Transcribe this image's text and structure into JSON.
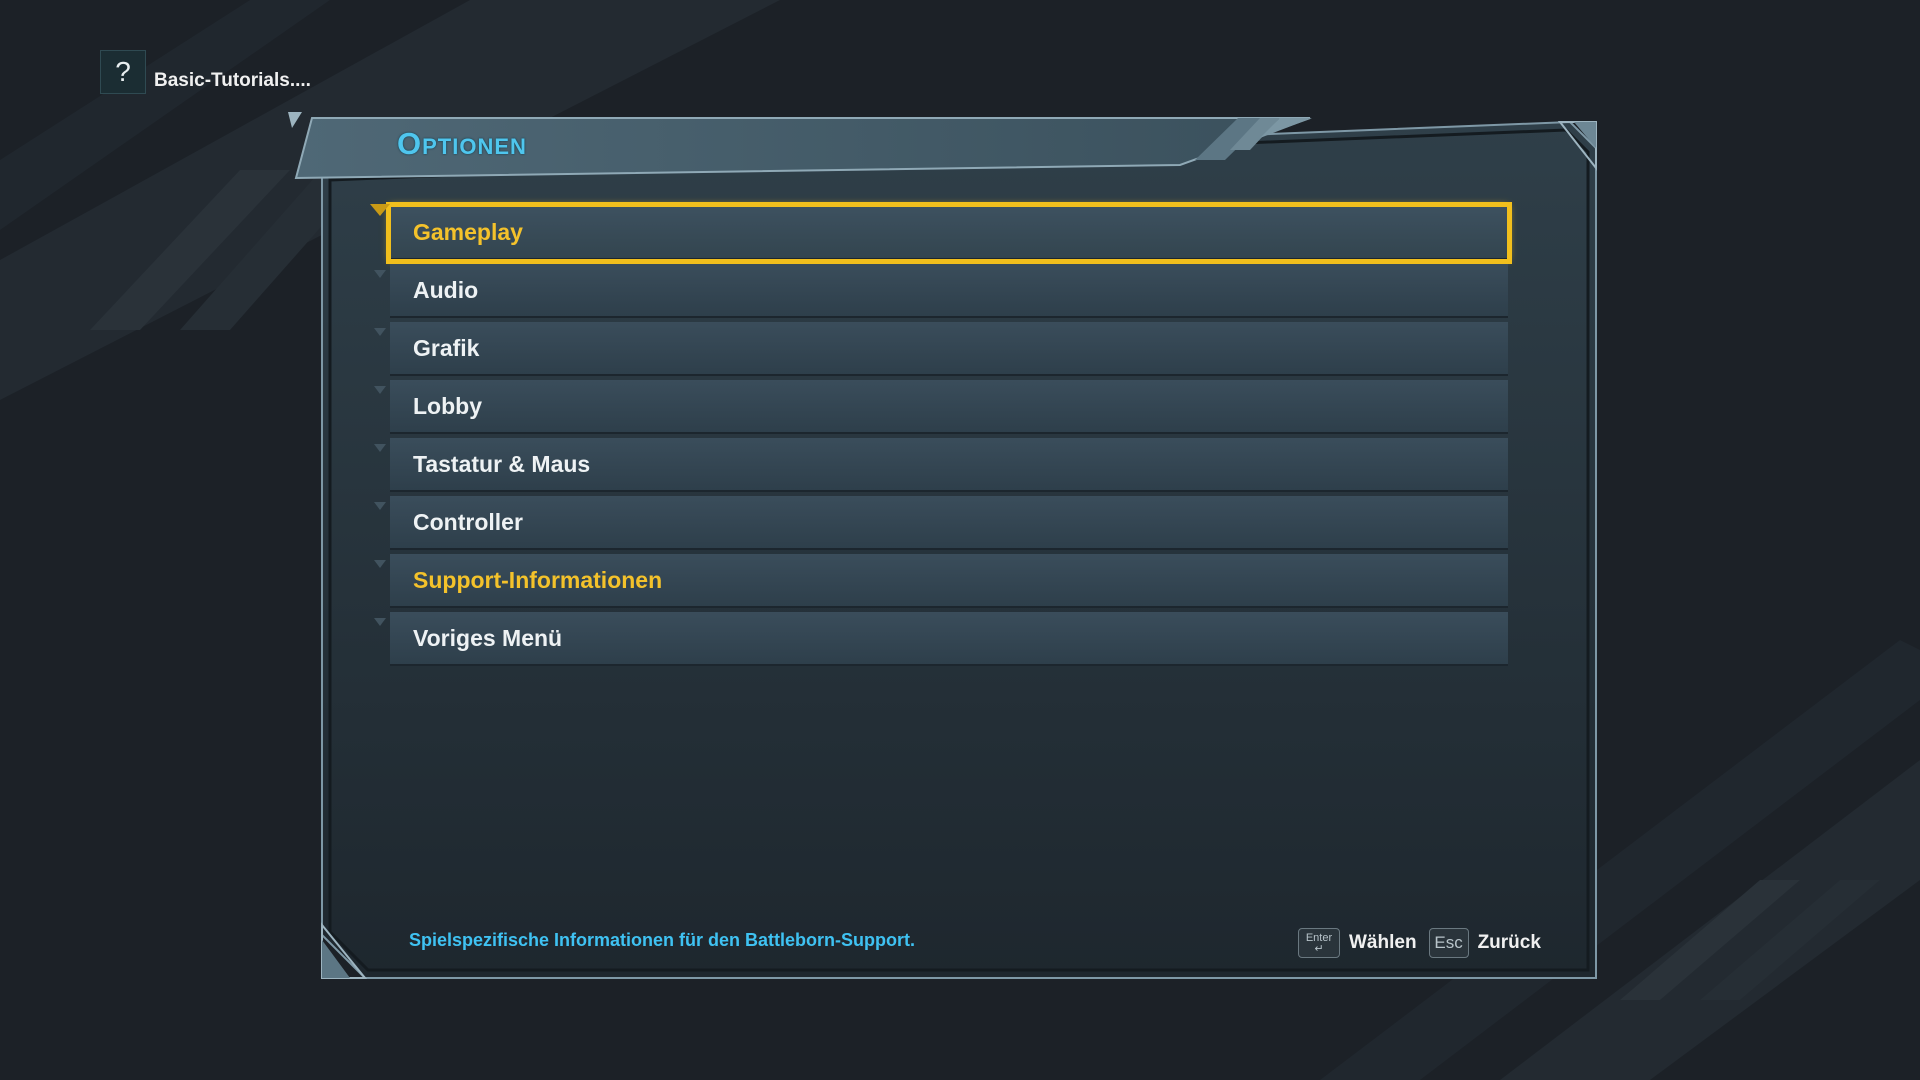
{
  "help_hint": {
    "icon": "question-icon",
    "glyph": "?",
    "label": "Basic-Tutorials...."
  },
  "panel": {
    "title": "Optionen"
  },
  "menu": {
    "items": [
      {
        "label": "Gameplay",
        "state": "selected"
      },
      {
        "label": "Audio",
        "state": "normal"
      },
      {
        "label": "Grafik",
        "state": "normal"
      },
      {
        "label": "Lobby",
        "state": "normal"
      },
      {
        "label": "Tastatur & Maus",
        "state": "normal"
      },
      {
        "label": "Controller",
        "state": "normal"
      },
      {
        "label": "Support-Informationen",
        "state": "highlight"
      },
      {
        "label": "Voriges Menü",
        "state": "normal"
      }
    ]
  },
  "description": "Spielspezifische Informationen für den Battleborn-Support.",
  "controls": {
    "select": {
      "key": "Enter",
      "key_icon": "enter-key-icon",
      "label": "Wählen"
    },
    "back": {
      "key": "Esc",
      "label": "Zurück"
    }
  },
  "colors": {
    "accent_blue": "#4fc6ee",
    "selection_yellow": "#f1bf1d",
    "background": "#1c2127",
    "panel": "#27343d"
  }
}
